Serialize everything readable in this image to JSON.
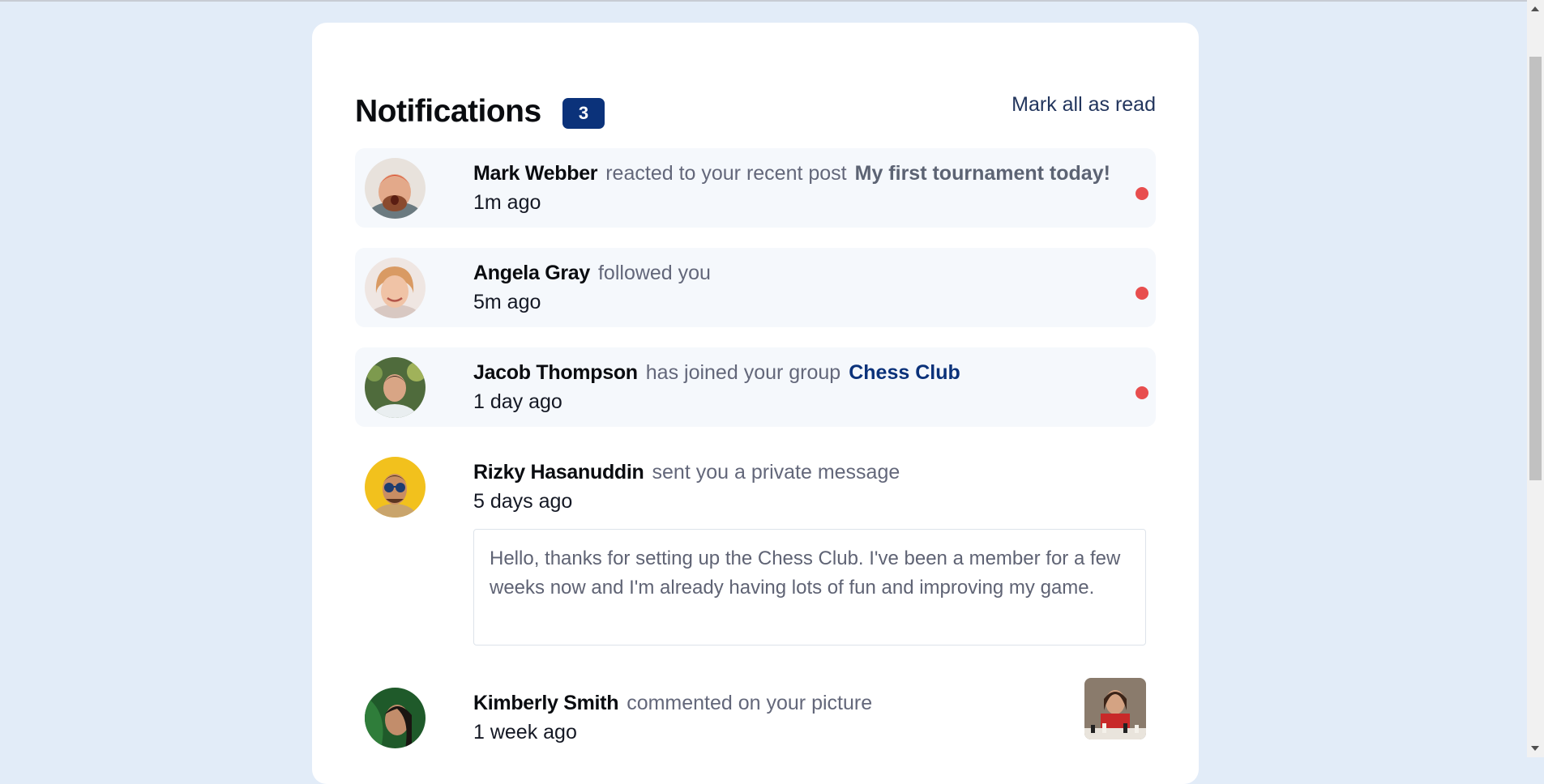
{
  "header": {
    "title": "Notifications",
    "count": "3",
    "mark_all": "Mark all as read"
  },
  "notifications": [
    {
      "name": "Mark Webber",
      "action": "reacted to your recent post",
      "target": "My first tournament today!",
      "time": "1m ago",
      "unread": true
    },
    {
      "name": "Angela Gray",
      "action": "followed you",
      "target": "",
      "time": "5m ago",
      "unread": true
    },
    {
      "name": "Jacob Thompson",
      "action": "has joined your group",
      "target": "Chess Club",
      "time": "1 day ago",
      "unread": true
    },
    {
      "name": "Rizky Hasanuddin",
      "action": "sent you a private message",
      "target": "",
      "time": "5 days ago",
      "unread": false,
      "message": "Hello, thanks for setting up the Chess Club. I've been a member for a few weeks now and I'm already having lots of fun and improving my game."
    },
    {
      "name": "Kimberly Smith",
      "action": "commented on your picture",
      "target": "",
      "time": "1 week ago",
      "unread": false
    }
  ],
  "colors": {
    "background": "#e2ecf8",
    "accent": "#0b327a",
    "unread_bg": "#f5f8fc",
    "unread_dot": "#e84e4e"
  }
}
